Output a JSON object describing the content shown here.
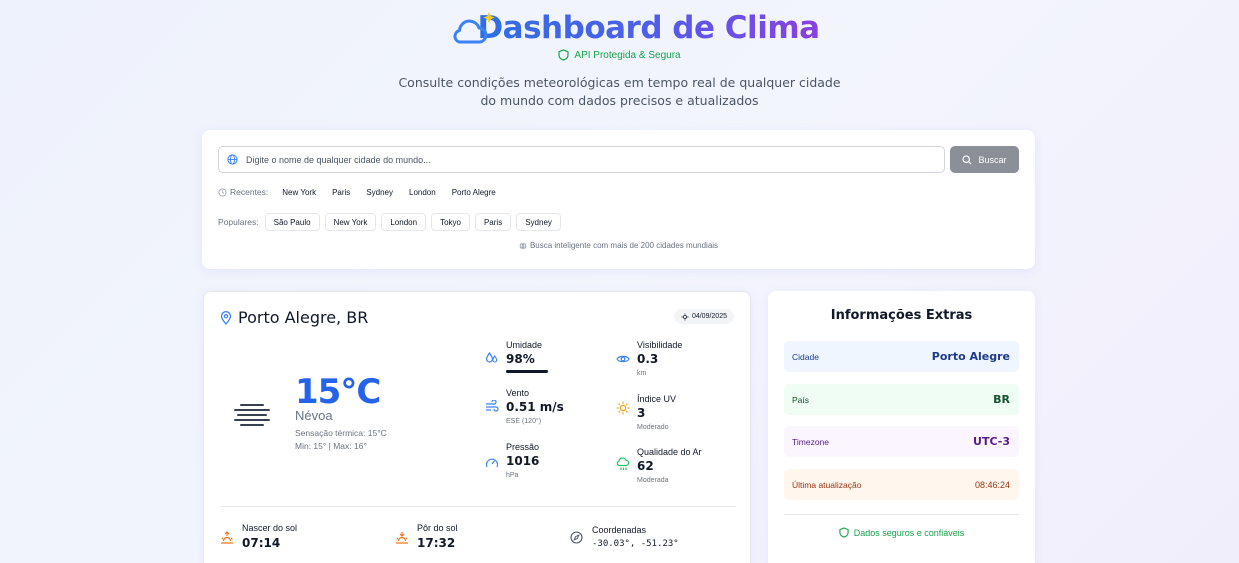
{
  "header": {
    "title": "Dashboard de Clima",
    "secure_label": "API Protegida & Segura",
    "subtitle": "Consulte condições meteorológicas em tempo real de qualquer cidade do mundo com dados precisos e atualizados"
  },
  "search": {
    "placeholder": "Digite o nome de qualquer cidade do mundo...",
    "button_label": "Buscar",
    "recent_label": "Recentes:",
    "recent": [
      "New York",
      "Paris",
      "Sydney",
      "London",
      "Porto Alegre"
    ],
    "popular_label": "Populares:",
    "popular": [
      "São Paulo",
      "New York",
      "London",
      "Tokyo",
      "Paris",
      "Sydney"
    ],
    "hint": "Busca inteligente com mais de 200 cidades mundiais"
  },
  "weather": {
    "location": "Porto Alegre, BR",
    "date": "04/09/2025",
    "icon": "fog-icon",
    "temperature": "15°C",
    "condition": "Névoa",
    "feels_like": "Sensação térmica: 15°C",
    "min_max": "Min: 15° | Max: 16°",
    "humidity": {
      "label": "Umidade",
      "value": "98%",
      "level": 0.98
    },
    "visibility": {
      "label": "Visibilidade",
      "value": "0.3",
      "unit": "km"
    },
    "wind": {
      "label": "Vento",
      "value": "0.51 m/s",
      "sub": "ESE (120°)"
    },
    "uv": {
      "label": "Índice UV",
      "value": "3",
      "sub": "Moderado"
    },
    "pressure": {
      "label": "Pressão",
      "value": "1016",
      "unit": "hPa"
    },
    "air_quality": {
      "label": "Qualidade do Ar",
      "value": "62",
      "sub": "Moderada"
    },
    "sunrise": {
      "label": "Nascer do sol",
      "value": "07:14"
    },
    "sunset": {
      "label": "Pôr do sol",
      "value": "17:32"
    },
    "coordinates": {
      "label": "Coordenadas",
      "value": "-30.03°, -51.23°"
    }
  },
  "extra": {
    "title": "Informações Extras",
    "city_label": "Cidade",
    "city_value": "Porto Alegre",
    "country_label": "País",
    "country_value": "BR",
    "timezone_label": "Timezone",
    "timezone_value": "UTC-3",
    "updated_label": "Última atualização",
    "updated_value": "08:46:24",
    "safe_label": "Dados seguros e confiáveis"
  },
  "colors": {
    "accent_blue": "#2563eb",
    "title_gradient_start": "#2f6fe4",
    "title_gradient_end": "#8b3fe0",
    "secure_green": "#16a34a",
    "sun_orange": "#f97316"
  }
}
